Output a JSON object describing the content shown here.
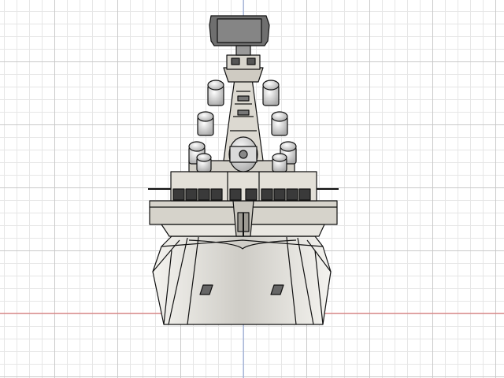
{
  "canvas": {
    "background": "#ffffff",
    "grid_minor_color": "#e6e6e6",
    "grid_major_color": "#c9c9c9",
    "x_axis_color": "#e06666",
    "y_axis_color": "#8fa8e0"
  },
  "model": {
    "subject": "naval-ship-front-view",
    "hull_fill": "#efeeea",
    "superstructure_fill": "#e3e0d8",
    "deck_fill": "#cdc9c0",
    "window_fill": "#3a3a3a",
    "outline_color": "#111111"
  }
}
